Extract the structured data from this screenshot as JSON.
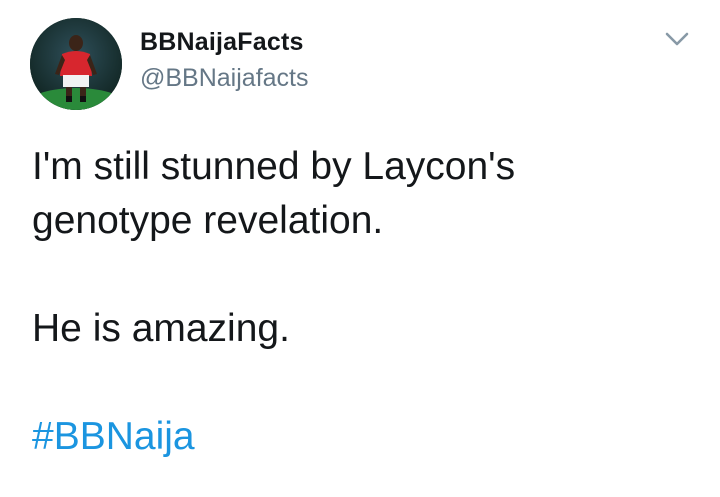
{
  "user": {
    "display_name": "BBNaijaFacts",
    "handle": "@BBNaijafacts",
    "avatar_icon": "person-in-red-jersey-avatar"
  },
  "menu": {
    "icon": "chevron-down-icon"
  },
  "tweet": {
    "lines": [
      "I'm still stunned by Laycon's",
      "genotype revelation.",
      "He is amazing."
    ],
    "hashtag": "#BBNaija"
  },
  "colors": {
    "text": "#14171a",
    "handle": "#657786",
    "hashtag": "#1b95e0",
    "chevron": "#8899a6"
  }
}
